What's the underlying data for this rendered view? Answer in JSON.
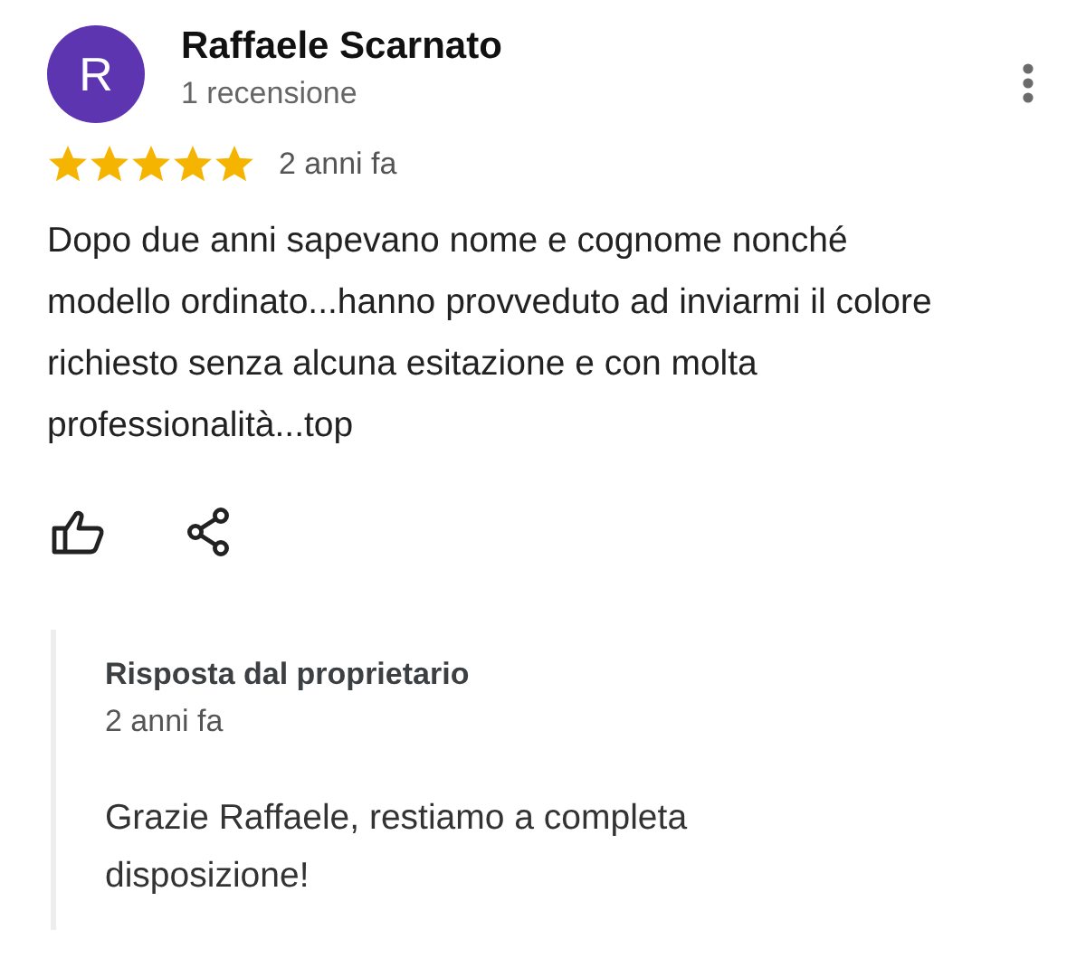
{
  "review": {
    "avatar_letter": "R",
    "author": "Raffaele Scarnato",
    "author_meta": "1 recensione",
    "stars": 5,
    "time": "2 anni fa",
    "text": "Dopo due anni sapevano nome e cognome nonché modello ordinato...hanno provveduto ad inviarmi il colore richiesto senza alcuna esitazione e con molta professionalità...top"
  },
  "owner_reply": {
    "title": "Risposta dal proprietario",
    "time": "2 anni fa",
    "text": "Grazie Raffaele, restiamo a completa disposizione!"
  }
}
